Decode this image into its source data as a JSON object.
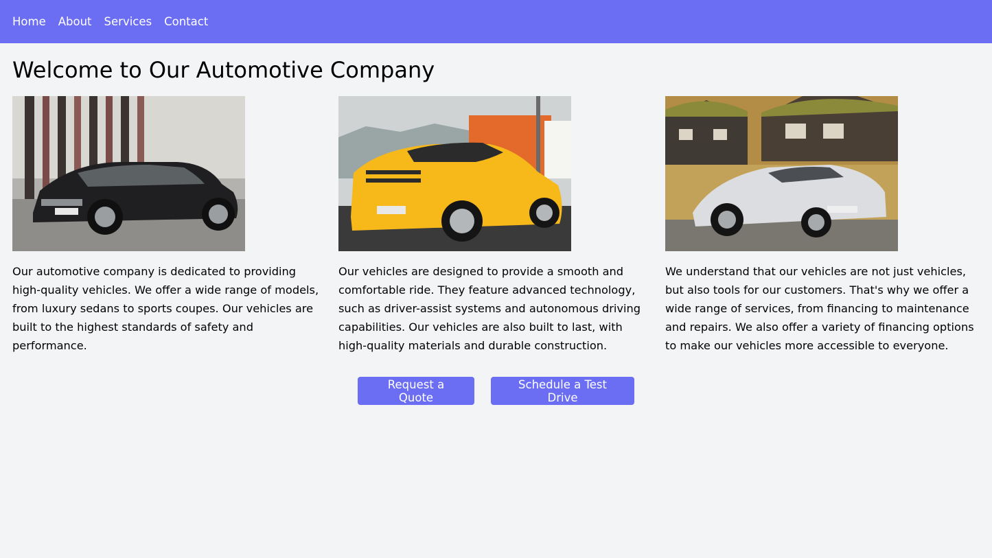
{
  "nav": {
    "items": [
      "Home",
      "About",
      "Services",
      "Contact"
    ]
  },
  "page": {
    "title": "Welcome to Our Automotive Company"
  },
  "features": [
    {
      "image": "black-sedan-photo",
      "text": "Our automotive company is dedicated to providing high-quality vehicles. We offer a wide range of models, from luxury sedans to sports coupes. Our vehicles are built to the highest standards of safety and performance."
    },
    {
      "image": "yellow-sports-car-photo",
      "text": "Our vehicles are designed to provide a smooth and comfortable ride. They feature advanced technology, such as driver-assist systems and autonomous driving capabilities. Our vehicles are also built to last, with high-quality materials and durable construction."
    },
    {
      "image": "white-supercar-photo",
      "text": "We understand that our vehicles are not just vehicles, but also tools for our customers. That's why we offer a wide range of services, from financing to maintenance and repairs. We also offer a variety of financing options to make our vehicles more accessible to everyone."
    }
  ],
  "actions": {
    "quote_label": "Request a Quote",
    "test_drive_label": "Schedule a Test Drive"
  },
  "colors": {
    "primary": "#6b6ef2",
    "background": "#f3f4f6",
    "text": "#000000"
  }
}
